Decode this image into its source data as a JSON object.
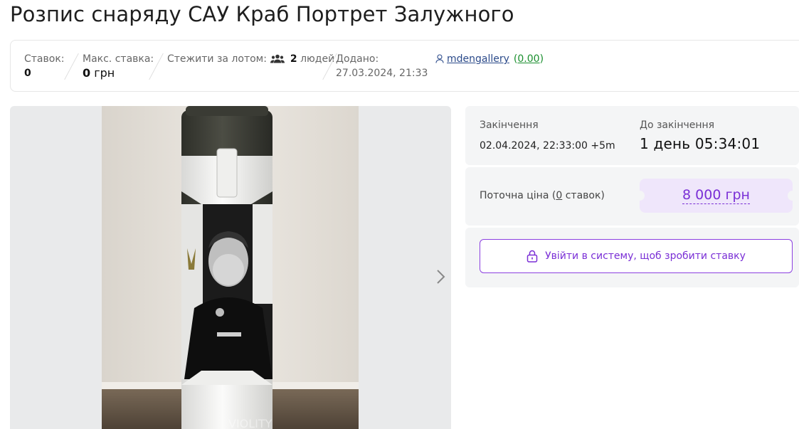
{
  "page": {
    "title": "Розпис снаряду САУ Краб Портрет Залужного"
  },
  "stats": {
    "bids_label": "Ставок:",
    "bids_value": "0",
    "max_bid_label": "Макс. ставка:",
    "max_bid_value": "0",
    "max_bid_currency": "грн",
    "watch_label": "Стежити за лотом:",
    "watch_icon": "people-icon",
    "watch_count": "2",
    "watch_suffix": "людей",
    "added_label": "Додано:",
    "added_value": "27.03.2024, 21:33",
    "seller_icon": "user-icon",
    "seller_name": "mdengallery",
    "seller_rating_open": "(",
    "seller_rating": "0.00",
    "seller_rating_close": ")"
  },
  "auction": {
    "end_label": "Закінчення",
    "end_value": "02.04.2024, 22:33:00 +5m",
    "time_left_label": "До закінчення",
    "time_left_value": "1 день 05:34:01",
    "price_label_prefix": "Поточна ціна (",
    "price_label_count": "0",
    "price_label_suffix": " ставок)",
    "price_value": "8 000 грн",
    "login_button": "Увійти в систему, щоб зробити ставку",
    "login_icon": "lock-icon"
  },
  "photo": {
    "next_icon": "chevron-right-icon",
    "watermark": "VIOLITY"
  },
  "colors": {
    "accent": "#7a2fd6",
    "accent_bg": "#efe6fb",
    "panel_bg": "#f4f5f6",
    "link": "#2b4a8a",
    "rating": "#1a8f2e"
  }
}
